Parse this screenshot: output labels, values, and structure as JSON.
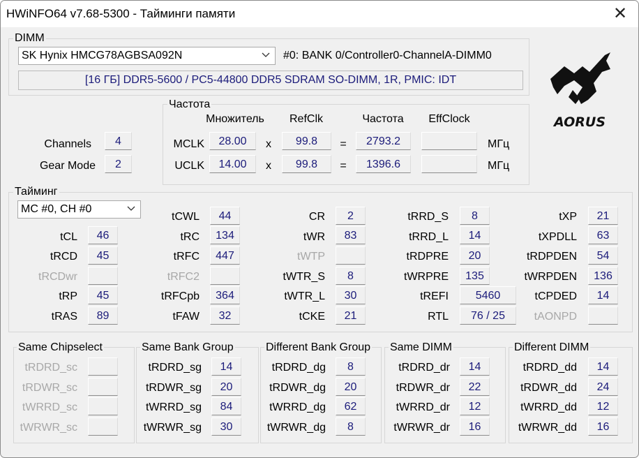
{
  "window": {
    "title": "HWiNFO64 v7.68-5300 - Тайминги памяти",
    "close_glyph": "✕"
  },
  "dimm": {
    "group_label": "DIMM",
    "module_selected": "SK Hynix HMCG78AGBSA092N",
    "slot": "#0: BANK 0/Controller0-ChannelA-DIMM0",
    "description": "[16 ГБ] DDR5-5600 / PC5-44800 DDR5 SDRAM SO-DIMM, 1R, PMIC: IDT"
  },
  "logo": {
    "text": "AORUS"
  },
  "frequency": {
    "group_label": "Частота",
    "headers": {
      "multiplier": "Множитель",
      "refclk": "RefClk",
      "freq": "Частота",
      "effclock": "EffClock"
    },
    "mclk": {
      "label": "MCLK",
      "multiplier": "28.00",
      "times": "x",
      "refclk": "99.8",
      "equals": "=",
      "freq": "2793.2",
      "effclock": "",
      "unit": "МГц"
    },
    "uclk": {
      "label": "UCLK",
      "multiplier": "14.00",
      "times": "x",
      "refclk": "99.8",
      "equals": "=",
      "freq": "1396.6",
      "effclock": "",
      "unit": "МГц"
    }
  },
  "channels": {
    "label": "Channels",
    "value": "4"
  },
  "gear_mode": {
    "label": "Gear Mode",
    "value": "2"
  },
  "timing": {
    "group_label": "Тайминг",
    "selector": "MC #0, CH #0",
    "tCL": {
      "label": "tCL",
      "value": "46"
    },
    "tRCD": {
      "label": "tRCD",
      "value": "45"
    },
    "tRCDwr": {
      "label": "tRCDwr",
      "value": ""
    },
    "tRP": {
      "label": "tRP",
      "value": "45"
    },
    "tRAS": {
      "label": "tRAS",
      "value": "89"
    },
    "tCWL": {
      "label": "tCWL",
      "value": "44"
    },
    "tRC": {
      "label": "tRC",
      "value": "134"
    },
    "tRFC": {
      "label": "tRFC",
      "value": "447"
    },
    "tRFC2": {
      "label": "tRFC2",
      "value": ""
    },
    "tRFCpb": {
      "label": "tRFCpb",
      "value": "364"
    },
    "tFAW": {
      "label": "tFAW",
      "value": "32"
    },
    "CR": {
      "label": "CR",
      "value": "2"
    },
    "tWR": {
      "label": "tWR",
      "value": "83"
    },
    "tWTP": {
      "label": "tWTP",
      "value": ""
    },
    "tWTR_S": {
      "label": "tWTR_S",
      "value": "8"
    },
    "tWTR_L": {
      "label": "tWTR_L",
      "value": "30"
    },
    "tCKE": {
      "label": "tCKE",
      "value": "21"
    },
    "tRRD_S": {
      "label": "tRRD_S",
      "value": "8"
    },
    "tRRD_L": {
      "label": "tRRD_L",
      "value": "14"
    },
    "tRDPRE": {
      "label": "tRDPRE",
      "value": "20"
    },
    "tWRPRE": {
      "label": "tWRPRE",
      "value": "135"
    },
    "tREFI": {
      "label": "tREFI",
      "value": "5460"
    },
    "RTL": {
      "label": "RTL",
      "value": "76 / 25"
    },
    "tXP": {
      "label": "tXP",
      "value": "21"
    },
    "tXPDLL": {
      "label": "tXPDLL",
      "value": "63"
    },
    "tRDPDEN": {
      "label": "tRDPDEN",
      "value": "54"
    },
    "tWRPDEN": {
      "label": "tWRPDEN",
      "value": "136"
    },
    "tCPDED": {
      "label": "tCPDED",
      "value": "14"
    },
    "tAONPD": {
      "label": "tAONPD",
      "value": ""
    }
  },
  "same_chipselect": {
    "group_label": "Same Chipselect",
    "rows": [
      {
        "label": "tRDRD_sc",
        "value": ""
      },
      {
        "label": "tRDWR_sc",
        "value": ""
      },
      {
        "label": "tWRRD_sc",
        "value": ""
      },
      {
        "label": "tWRWR_sc",
        "value": ""
      }
    ]
  },
  "same_bank_group": {
    "group_label": "Same Bank Group",
    "rows": [
      {
        "label": "tRDRD_sg",
        "value": "14"
      },
      {
        "label": "tRDWR_sg",
        "value": "20"
      },
      {
        "label": "tWRRD_sg",
        "value": "84"
      },
      {
        "label": "tWRWR_sg",
        "value": "30"
      }
    ]
  },
  "different_bank_group": {
    "group_label": "Different Bank Group",
    "rows": [
      {
        "label": "tRDRD_dg",
        "value": "8"
      },
      {
        "label": "tRDWR_dg",
        "value": "20"
      },
      {
        "label": "tWRRD_dg",
        "value": "62"
      },
      {
        "label": "tWRWR_dg",
        "value": "8"
      }
    ]
  },
  "same_dimm": {
    "group_label": "Same DIMM",
    "rows": [
      {
        "label": "tRDRD_dr",
        "value": "14"
      },
      {
        "label": "tRDWR_dr",
        "value": "22"
      },
      {
        "label": "tWRRD_dr",
        "value": "12"
      },
      {
        "label": "tWRWR_dr",
        "value": "16"
      }
    ]
  },
  "different_dimm": {
    "group_label": "Different DIMM",
    "rows": [
      {
        "label": "tRDRD_dd",
        "value": "14"
      },
      {
        "label": "tRDWR_dd",
        "value": "24"
      },
      {
        "label": "tWRRD_dd",
        "value": "12"
      },
      {
        "label": "tWRWR_dd",
        "value": "16"
      }
    ]
  },
  "colors": {
    "value_text": "#1b1b7a",
    "disabled_text": "#a8a8a8",
    "window_bg": "#f0f0f0"
  }
}
